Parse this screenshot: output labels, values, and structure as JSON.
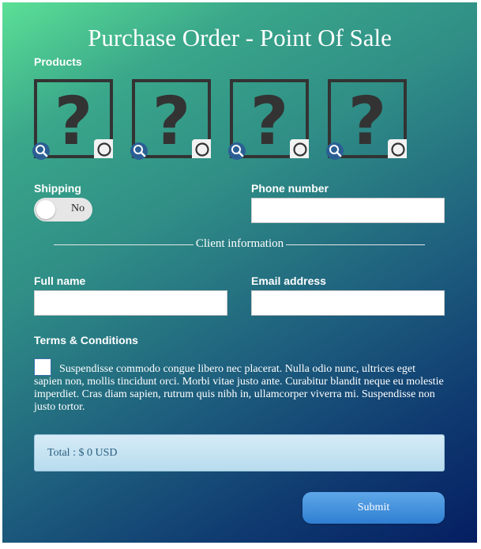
{
  "title": "Purchase Order - Point Of Sale",
  "products": {
    "label": "Products",
    "items": [
      {
        "icon": "question-mark-placeholder-icon"
      },
      {
        "icon": "question-mark-placeholder-icon"
      },
      {
        "icon": "question-mark-placeholder-icon"
      },
      {
        "icon": "question-mark-placeholder-icon"
      }
    ],
    "glyph": "?"
  },
  "shipping": {
    "label": "Shipping",
    "toggle_label": "No",
    "on": false
  },
  "phone": {
    "label": "Phone number",
    "value": ""
  },
  "client_section": {
    "label": "Client information"
  },
  "full_name": {
    "label": "Full name",
    "value": ""
  },
  "email": {
    "label": "Email address",
    "value": ""
  },
  "terms": {
    "label": "Terms & Conditions",
    "text": "Suspendisse commodo congue libero nec placerat. Nulla odio nunc, ultrices eget sapien non, mollis tincidunt orci. Morbi vitae justo ante. Curabitur blandit neque eu molestie imperdiet. Cras diam sapien, rutrum quis nibh in, ullamcorper viverra mi. Suspendisse non justo tortor.",
    "checked": false
  },
  "total": {
    "text": "Total : $ 0 USD"
  },
  "submit": {
    "label": "Submit"
  },
  "colors": {
    "accent": "#2f7ed2",
    "gradient_start": "#5be096",
    "gradient_end": "#051e62"
  }
}
